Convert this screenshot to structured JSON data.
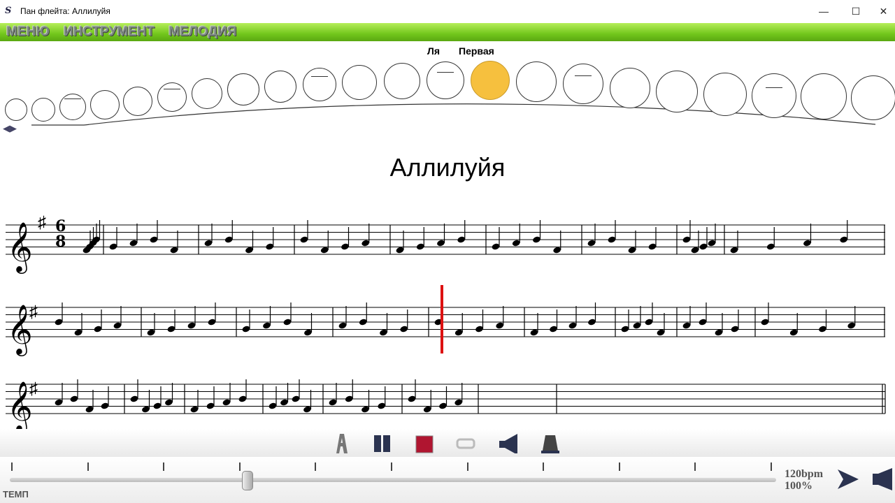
{
  "window": {
    "title": "Пан флейта: Аллилуйя",
    "minimize": "—",
    "maximize": "☐",
    "close": "✕"
  },
  "menu": [
    "МЕНЮ",
    "ИНСТРУМЕНТ",
    "МЕЛОДИЯ"
  ],
  "flute": {
    "note_label": "Ля",
    "octave_label": "Первая",
    "highlighted_hole": 13,
    "hole_count": 22,
    "nav": "◀▶"
  },
  "song": {
    "title": "Аллилуйя",
    "key": "♯",
    "time_signature": [
      "6",
      "8"
    ]
  },
  "toolbar": {
    "icons": [
      "font-icon",
      "pause-icon",
      "stop-icon",
      "repeat-icon",
      "volume-icon",
      "metronome-icon"
    ]
  },
  "tempo": {
    "label": "ТЕМП",
    "bpm": "120bpm",
    "percent": "100%",
    "value_fraction": 0.31
  },
  "colors": {
    "menu_bar": "#72c61c",
    "highlight": "#f6c03e",
    "playhead": "#dd1111"
  }
}
